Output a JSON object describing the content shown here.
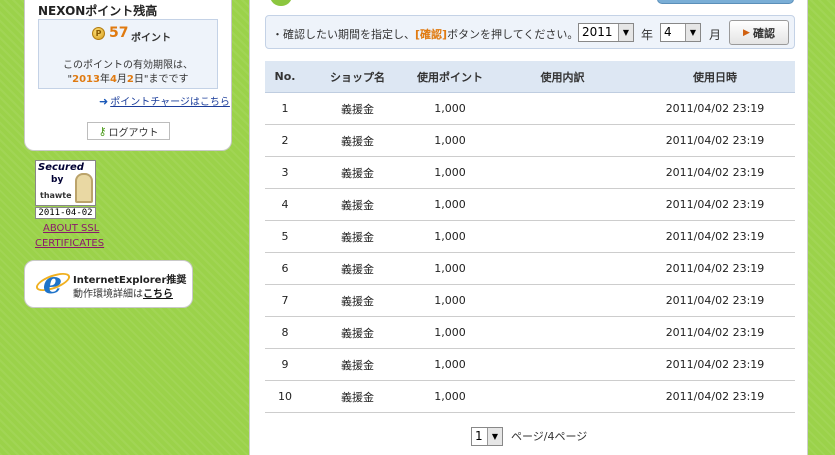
{
  "sidebar": {
    "point_title": "NEXONポイント残高",
    "coin_glyph": "P",
    "point_value": "57",
    "point_unit": "ポイント",
    "expiry_line1": "このポイントの有効期限は、",
    "expiry_open": "\"",
    "expiry_year": "2013",
    "expiry_year_unit": "年",
    "expiry_month": "4",
    "expiry_month_unit": "月",
    "expiry_day": "2",
    "expiry_day_unit": "日",
    "expiry_close": "\"までです",
    "charge_link": "ポイントチャージはこちら",
    "logout_label": "ログアウト",
    "ssl_secured": "Secured",
    "ssl_by": "by",
    "ssl_thawte": "thawte",
    "ssl_date": "2011-04-02",
    "ssl_about_line1": "ABOUT SSL",
    "ssl_about_line2": "CERTIFICATES",
    "ie_glyph": "e",
    "ie_title": "InternetExplorer推奨",
    "ie_desc_prefix": "動作環境詳細は",
    "ie_link": "こちら"
  },
  "filter": {
    "text_before": "・確認したい期間を指定し、",
    "text_highlight": "[確認]",
    "text_after": "ボタンを押してください。",
    "year_value": "2011",
    "year_label": "年",
    "month_value": "4",
    "month_label": "月",
    "confirm_label": "確認",
    "dropdown_glyph": "▼",
    "arrow_glyph": "▶"
  },
  "table": {
    "headers": {
      "no": "No.",
      "shop": "ショップ名",
      "point": "使用ポイント",
      "detail": "使用内訳",
      "date": "使用日時"
    },
    "rows": [
      {
        "no": "1",
        "shop": "義援金",
        "point": "1,000",
        "detail": "",
        "date": "2011/04/02 23:19"
      },
      {
        "no": "2",
        "shop": "義援金",
        "point": "1,000",
        "detail": "",
        "date": "2011/04/02 23:19"
      },
      {
        "no": "3",
        "shop": "義援金",
        "point": "1,000",
        "detail": "",
        "date": "2011/04/02 23:19"
      },
      {
        "no": "4",
        "shop": "義援金",
        "point": "1,000",
        "detail": "",
        "date": "2011/04/02 23:19"
      },
      {
        "no": "5",
        "shop": "義援金",
        "point": "1,000",
        "detail": "",
        "date": "2011/04/02 23:19"
      },
      {
        "no": "6",
        "shop": "義援金",
        "point": "1,000",
        "detail": "",
        "date": "2011/04/02 23:19"
      },
      {
        "no": "7",
        "shop": "義援金",
        "point": "1,000",
        "detail": "",
        "date": "2011/04/02 23:19"
      },
      {
        "no": "8",
        "shop": "義援金",
        "point": "1,000",
        "detail": "",
        "date": "2011/04/02 23:19"
      },
      {
        "no": "9",
        "shop": "義援金",
        "point": "1,000",
        "detail": "",
        "date": "2011/04/02 23:19"
      },
      {
        "no": "10",
        "shop": "義援金",
        "point": "1,000",
        "detail": "",
        "date": "2011/04/02 23:19"
      }
    ]
  },
  "pager": {
    "current_page": "1",
    "text": "ページ/4ページ"
  },
  "icons": {
    "charge_arrow": "➜",
    "key": "⚷"
  },
  "colors": {
    "background": "#9bd24a",
    "accent": "#e07a10",
    "header_bg": "#dde7f3"
  }
}
